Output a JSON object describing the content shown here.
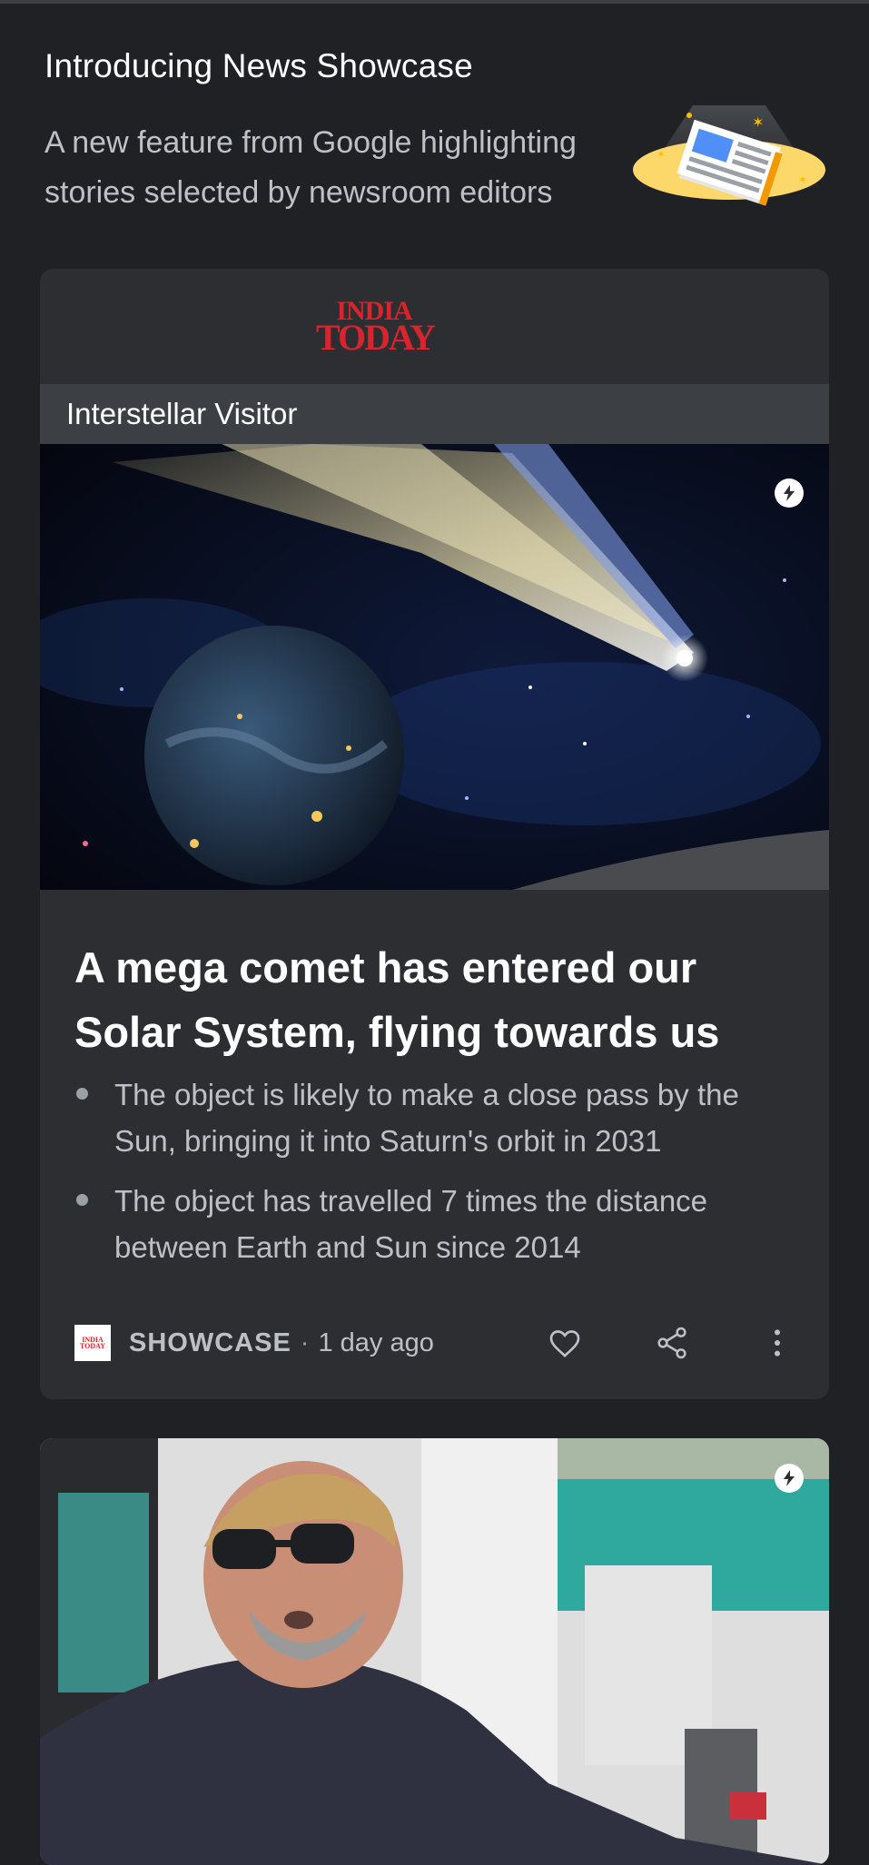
{
  "intro": {
    "title": "Introducing News Showcase",
    "description": "A new feature from Google highlighting stories selected by newsroom editors",
    "illustration_icon": "newspaper-spotlight-icon"
  },
  "story_card": {
    "publisher_logo_line1": "INDIA",
    "publisher_logo_line2": "TODAY",
    "topic": "Interstellar Visitor",
    "image_icon": "comet-planet-image",
    "amp_icon": "lightning-bolt-icon",
    "headline": "A mega comet has entered our Solar System, flying towards us",
    "bullets": [
      "The object is likely to make a close pass by the Sun, bringing it into Saturn's orbit in 2031",
      "The object has travelled 7 times the distance between Earth and Sun since 2014"
    ],
    "source_logo_line1": "INDIA",
    "source_logo_line2": "TODAY",
    "source_label": "SHOWCASE",
    "separator": "·",
    "time": "1 day ago"
  },
  "next_card": {
    "image_icon": "man-sunglasses-boat-photo",
    "amp_icon": "lightning-bolt-icon"
  },
  "colors": {
    "background": "#202124",
    "card": "#2d2e31",
    "topic_bar": "#3c3f44",
    "brand_red": "#d8242d"
  }
}
